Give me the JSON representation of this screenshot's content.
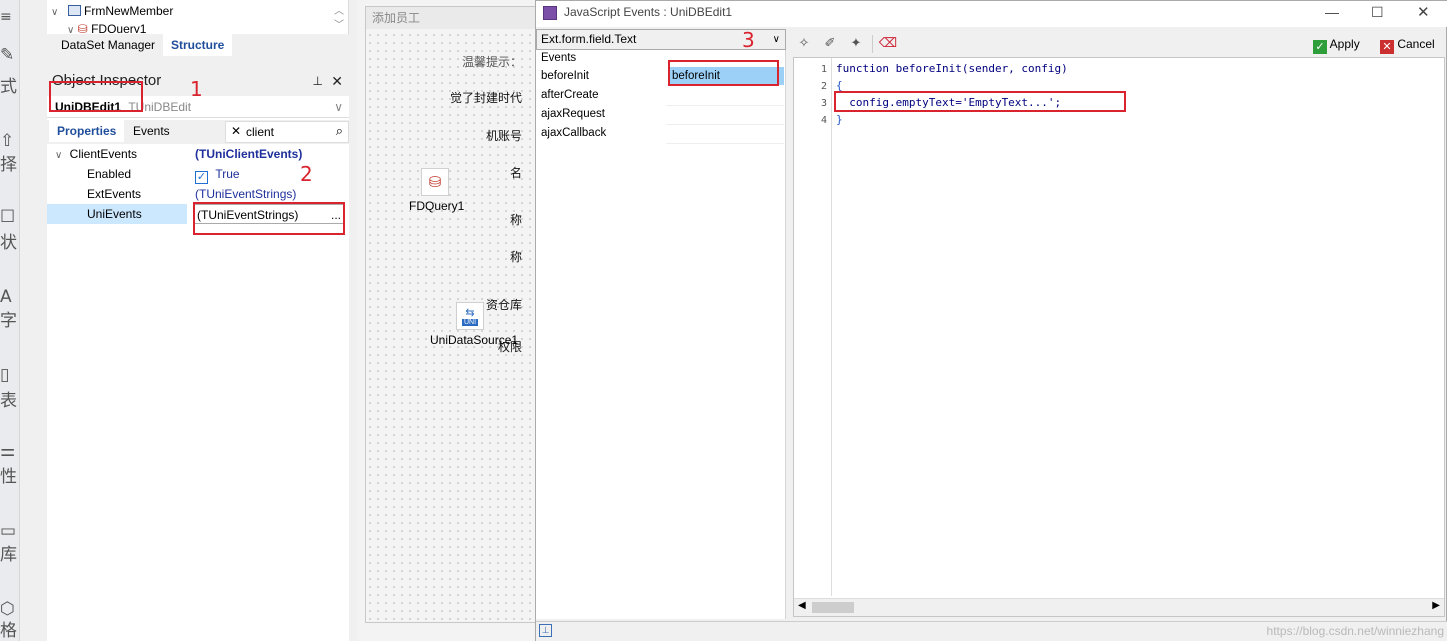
{
  "left_strip": {
    "items": [
      {
        "icon": "menu-icon",
        "glyph": "≡"
      },
      {
        "icon": "pen-icon",
        "glyph": "✎",
        "label": "式"
      },
      {
        "icon": "pointer-icon",
        "glyph": "⇧",
        "label": "择"
      },
      {
        "icon": "chat-icon",
        "glyph": "☐",
        "label": "状"
      },
      {
        "icon": "text-icon",
        "glyph": "A",
        "label": "字"
      },
      {
        "icon": "table-icon",
        "glyph": "▯",
        "label": "表"
      },
      {
        "icon": "sliders-icon",
        "glyph": "⚌",
        "label": "性"
      },
      {
        "icon": "image-icon",
        "glyph": "▭",
        "label": "库"
      },
      {
        "icon": "hex-icon",
        "glyph": "⬡",
        "label": "格"
      }
    ]
  },
  "structure": {
    "rows": [
      "FrmNewMember",
      "FDQuery1"
    ],
    "tabs": [
      "DataSet Manager",
      "Structure"
    ]
  },
  "object_inspector": {
    "title": "Object Inspector",
    "selected_name": "UniDBEdit1",
    "selected_type": "TUniDBEdit",
    "tabs": [
      "Properties",
      "Events"
    ],
    "search_value": "client",
    "properties": [
      {
        "name": "ClientEvents",
        "value": "(TUniClientEvents)"
      },
      {
        "name": "Enabled",
        "value": "True"
      },
      {
        "name": "ExtEvents",
        "value": "(TUniEventStrings)"
      },
      {
        "name": "UniEvents",
        "value": "(TUniEventStrings)"
      }
    ],
    "ellipsis": "..."
  },
  "designer": {
    "form_caption": "添加员工",
    "labels": [
      "温馨提示：",
      "觉了封建时代",
      "机账号",
      "名",
      "称",
      "称",
      "资仓库",
      "权限"
    ],
    "components": [
      {
        "name": "FDQuery1"
      },
      {
        "name": "UniDataSource1",
        "badge": "UNI"
      }
    ]
  },
  "js_events": {
    "window_title": "JavaScript Events : UniDBEdit1",
    "class_combo": "Ext.form.field.Text",
    "events": [
      "Events",
      "beforeInit",
      "afterCreate",
      "ajaxRequest",
      "ajaxCallback"
    ],
    "selected_event": "beforeInit",
    "apply_label": "Apply",
    "cancel_label": "Cancel",
    "code_lines": [
      {
        "n": "1",
        "text": "function beforeInit(sender, config)"
      },
      {
        "n": "2",
        "text": "{"
      },
      {
        "n": "3",
        "text": "  config.emptyText='EmptyText...';"
      },
      {
        "n": "4",
        "text": "}"
      }
    ]
  },
  "annotations": [
    "1",
    "2",
    "3"
  ],
  "watermark": "https://blog.csdn.net/winniezhang",
  "colors": {
    "accent": "#1f4e9b",
    "highlight": "#cce8ff",
    "annotation_red": "#d9232e",
    "apply_green": "#2e9e3a",
    "cancel_red": "#cc2f2f"
  }
}
